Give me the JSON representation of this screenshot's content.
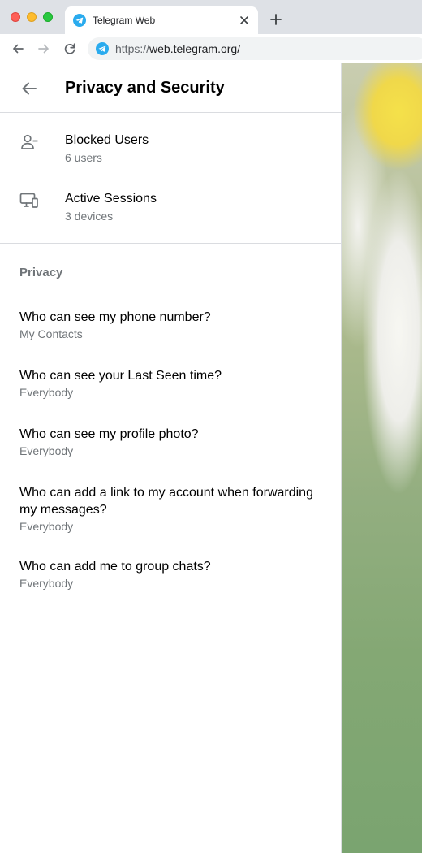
{
  "browser": {
    "tab_title": "Telegram Web",
    "url_scheme": "https://",
    "url_host": "web.telegram.org/"
  },
  "header": {
    "title": "Privacy and Security"
  },
  "security_items": [
    {
      "title": "Blocked Users",
      "subtitle": "6 users",
      "icon": "block-user-icon"
    },
    {
      "title": "Active Sessions",
      "subtitle": "3 devices",
      "icon": "devices-icon"
    }
  ],
  "privacy": {
    "section_title": "Privacy",
    "items": [
      {
        "title": "Who can see my phone number?",
        "subtitle": "My Contacts"
      },
      {
        "title": "Who can see your Last Seen time?",
        "subtitle": "Everybody"
      },
      {
        "title": "Who can see my profile photo?",
        "subtitle": "Everybody"
      },
      {
        "title": "Who can add a link to my account when forwarding my messages?",
        "subtitle": "Everybody"
      },
      {
        "title": "Who can add me to group chats?",
        "subtitle": "Everybody"
      }
    ]
  },
  "colors": {
    "accent": "#2AABEE",
    "secondary_text": "#707579"
  }
}
